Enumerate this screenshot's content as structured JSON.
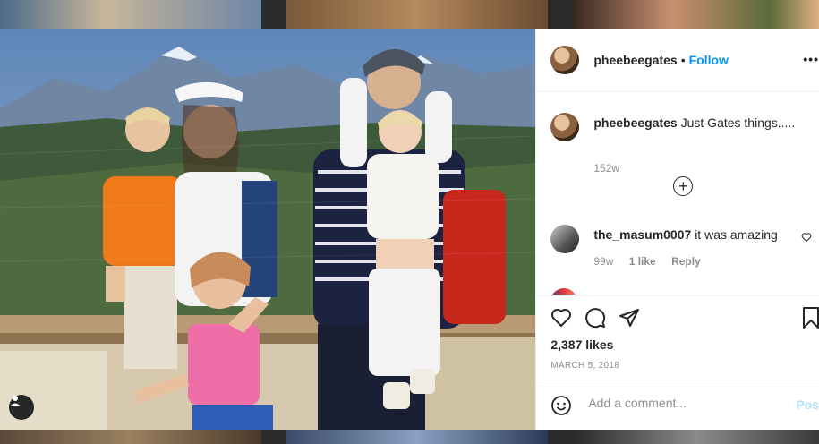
{
  "post": {
    "username": "pheebeegates",
    "follow_label": "Follow",
    "separator": "•",
    "more_label": "•••",
    "caption_text": "Just Gates things.....",
    "caption_age": "152w",
    "load_more_label": "+",
    "likes": "2,387 likes",
    "date": "MARCH 5, 2018"
  },
  "comments": [
    {
      "username": "the_masum0007",
      "text": "it was amazing",
      "age": "99w",
      "likes": "1 like",
      "reply_label": "Reply"
    }
  ],
  "add_comment": {
    "placeholder": "Add a comment...",
    "post_label": "Post"
  },
  "icons": {
    "like": "heart-icon",
    "comment": "comment-icon",
    "share": "paper-plane-icon",
    "save": "bookmark-icon",
    "emoji": "smiley-icon",
    "user_tag": "user-icon"
  },
  "colors": {
    "link": "#0095f6",
    "post_disabled": "#b2dffc",
    "secondary_text": "#8e8e8e"
  }
}
